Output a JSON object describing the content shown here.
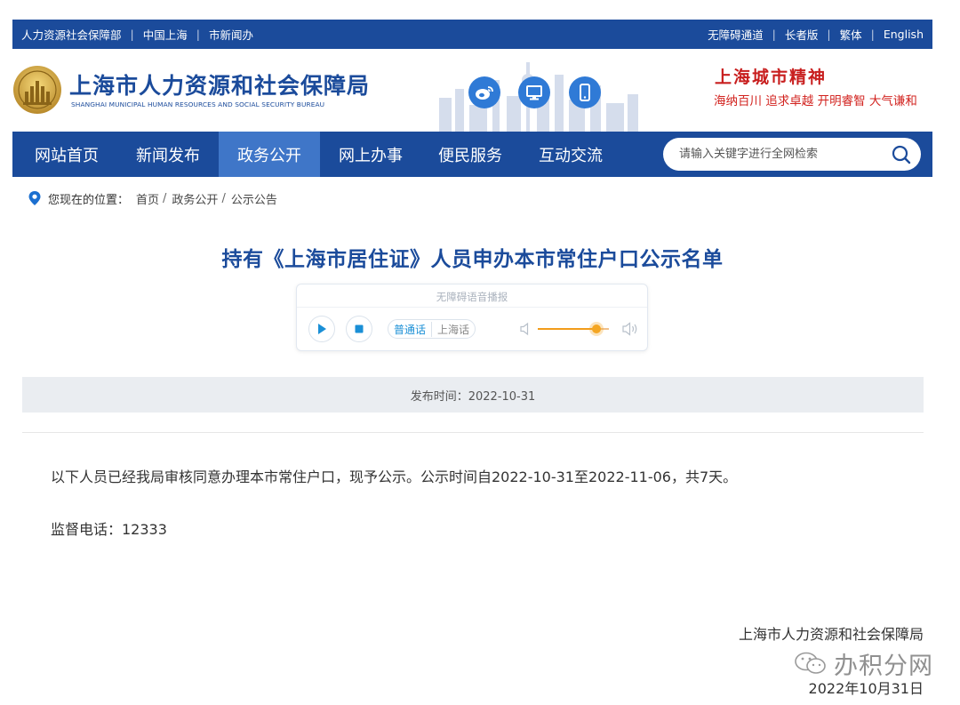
{
  "topbar": {
    "left_links": [
      "人力资源社会保障部",
      "中国上海",
      "市新闻办"
    ],
    "right_links": [
      "无障碍通道",
      "长者版",
      "繁体",
      "English"
    ]
  },
  "header": {
    "logo_cn": "上海市人力资源和社会保障局",
    "logo_en": "SHANGHAI MUNICIPAL HUMAN RESOURCES AND SOCIAL SECURITY BUREAU",
    "social_icons": [
      "weibo-icon",
      "monitor-icon",
      "mobile-icon"
    ],
    "slogan_title": "上海城市精神",
    "slogan_sub": "海纳百川  追求卓越  开明睿智  大气谦和"
  },
  "nav": {
    "items": [
      "网站首页",
      "新闻发布",
      "政务公开",
      "网上办事",
      "便民服务",
      "互动交流"
    ],
    "active": "政务公开",
    "search_placeholder": "请输入关键字进行全网检索"
  },
  "breadcrumb": {
    "label": "您现在的位置：",
    "items": [
      "首页",
      "政务公开",
      "公示公告"
    ]
  },
  "article": {
    "title": "持有《上海市居住证》人员申办本市常住户口公示名单",
    "publish_time": "发布时间：2022-10-31",
    "paragraph": "以下人员已经我局审核同意办理本市常住户口，现予公示。公示时间自2022-10-31至2022-11-06，共7天。",
    "phone": "监督电话：12333",
    "signature_org": "上海市人力资源和社会保障局",
    "signature_date": "2022年10月31日"
  },
  "player": {
    "title": "无障碍语音播报",
    "lang_mandarin": "普通话",
    "lang_shanghainese": "上海话",
    "volume": 0.82
  },
  "watermark": {
    "text": "办积分网"
  },
  "colors": {
    "brand_blue": "#1b4b9b",
    "nav_active": "#3f76c8",
    "slogan_red": "#c81e1e",
    "volume_orange": "#f4a623"
  }
}
